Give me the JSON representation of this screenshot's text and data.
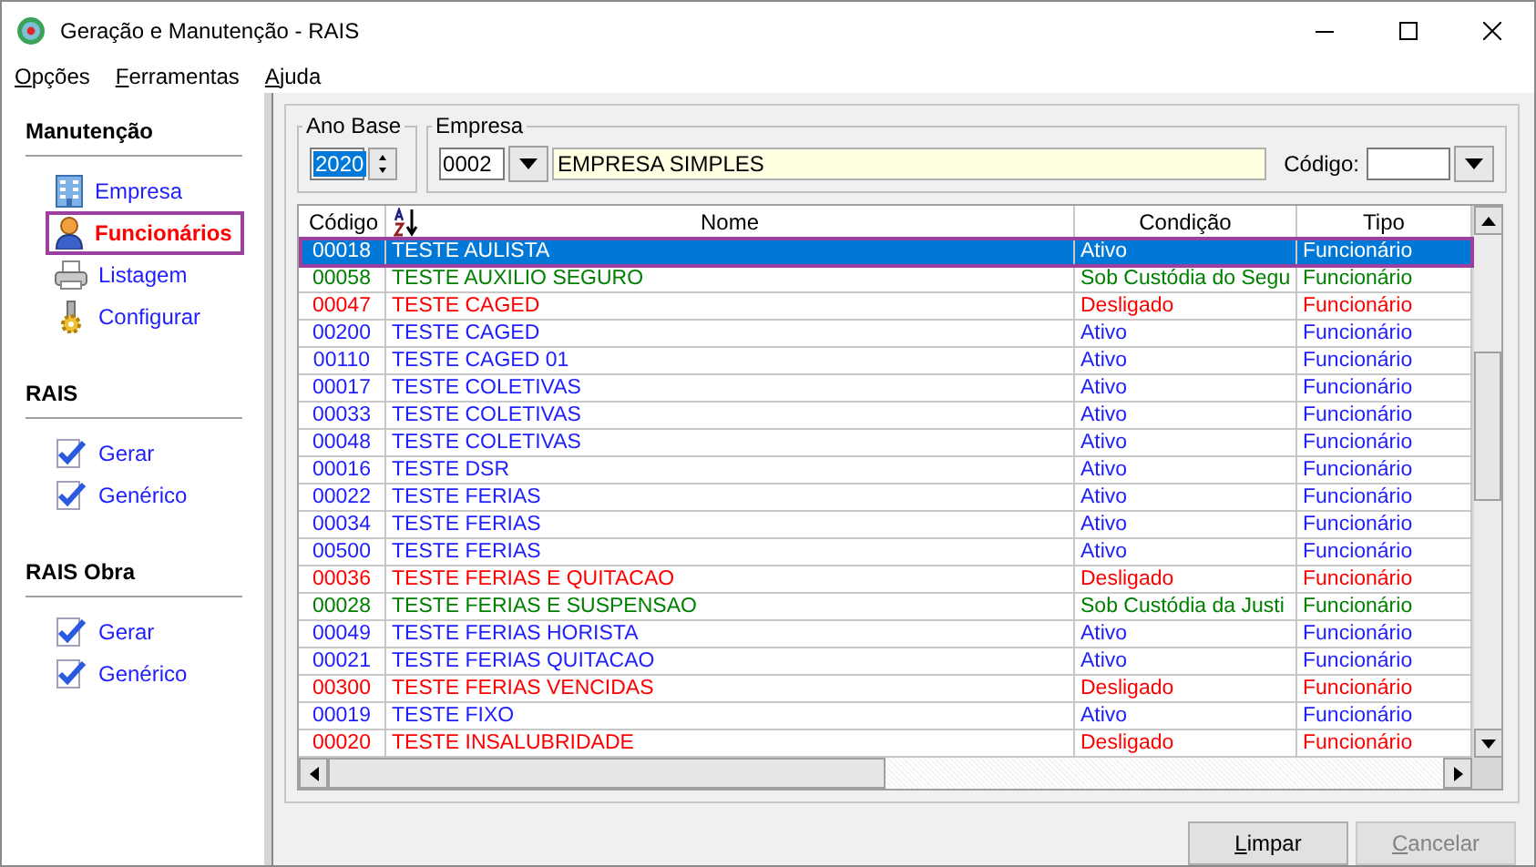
{
  "window": {
    "title": "Geração e Manutenção - RAIS"
  },
  "menu": [
    "Opções",
    "Ferramentas",
    "Ajuda"
  ],
  "sidebar": [
    {
      "title": "Manutenção",
      "items": [
        {
          "label": "Empresa",
          "kind": "building",
          "selected": false
        },
        {
          "label": "Funcionários",
          "kind": "person",
          "selected": true
        },
        {
          "label": "Listagem",
          "kind": "printer",
          "selected": false
        },
        {
          "label": "Configurar",
          "kind": "gear",
          "selected": false
        }
      ]
    },
    {
      "title": "RAIS",
      "items": [
        {
          "label": "Gerar",
          "kind": "check",
          "selected": false
        },
        {
          "label": "Genérico",
          "kind": "check",
          "selected": false
        }
      ]
    },
    {
      "title": "RAIS Obra",
      "items": [
        {
          "label": "Gerar",
          "kind": "check",
          "selected": false
        },
        {
          "label": "Genérico",
          "kind": "check",
          "selected": false
        }
      ]
    }
  ],
  "filters": {
    "ano_base": {
      "label": "Ano Base",
      "value": "2020"
    },
    "empresa": {
      "label": "Empresa",
      "code": "0002",
      "name": "EMPRESA SIMPLES"
    },
    "codigo": {
      "label": "Código:"
    }
  },
  "table": {
    "columns": [
      {
        "label": "Código",
        "sorted": false
      },
      {
        "label": "Nome",
        "sorted": true
      },
      {
        "label": "Condição",
        "sorted": false
      },
      {
        "label": "Tipo",
        "sorted": false
      }
    ],
    "rows": [
      {
        "code": "00018",
        "name": "TESTE AULISTA",
        "condition": "Ativo",
        "type": "Funcionário",
        "selected": true
      },
      {
        "code": "00058",
        "name": "TESTE AUXILIO SEGURO",
        "condition": "Sob Custódia do Segu",
        "type": "Funcionário",
        "color": "#008000",
        "selected": false
      },
      {
        "code": "00047",
        "name": "TESTE CAGED",
        "condition": "Desligado",
        "type": "Funcionário",
        "color": "#ff0000",
        "selected": false
      },
      {
        "code": "00200",
        "name": "TESTE CAGED",
        "condition": "Ativo",
        "type": "Funcionário",
        "color": "#1e1eff",
        "selected": false
      },
      {
        "code": "00110",
        "name": "TESTE CAGED 01",
        "condition": "Ativo",
        "type": "Funcionário",
        "color": "#1e1eff",
        "selected": false
      },
      {
        "code": "00017",
        "name": "TESTE COLETIVAS",
        "condition": "Ativo",
        "type": "Funcionário",
        "color": "#1e1eff",
        "selected": false
      },
      {
        "code": "00033",
        "name": "TESTE COLETIVAS",
        "condition": "Ativo",
        "type": "Funcionário",
        "color": "#1e1eff",
        "selected": false
      },
      {
        "code": "00048",
        "name": "TESTE COLETIVAS",
        "condition": "Ativo",
        "type": "Funcionário",
        "color": "#1e1eff",
        "selected": false
      },
      {
        "code": "00016",
        "name": "TESTE DSR",
        "condition": "Ativo",
        "type": "Funcionário",
        "color": "#1e1eff",
        "selected": false
      },
      {
        "code": "00022",
        "name": "TESTE FERIAS",
        "condition": "Ativo",
        "type": "Funcionário",
        "color": "#1e1eff",
        "selected": false
      },
      {
        "code": "00034",
        "name": "TESTE FERIAS",
        "condition": "Ativo",
        "type": "Funcionário",
        "color": "#1e1eff",
        "selected": false
      },
      {
        "code": "00500",
        "name": "TESTE FERIAS",
        "condition": "Ativo",
        "type": "Funcionário",
        "color": "#1e1eff",
        "selected": false
      },
      {
        "code": "00036",
        "name": "TESTE FERIAS E QUITACAO",
        "condition": "Desligado",
        "type": "Funcionário",
        "color": "#ff0000",
        "selected": false
      },
      {
        "code": "00028",
        "name": "TESTE FERIAS E SUSPENSAO",
        "condition": "Sob Custódia da Justi",
        "type": "Funcionário",
        "color": "#008000",
        "selected": false
      },
      {
        "code": "00049",
        "name": "TESTE FERIAS HORISTA",
        "condition": "Ativo",
        "type": "Funcionário",
        "color": "#1e1eff",
        "selected": false
      },
      {
        "code": "00021",
        "name": "TESTE FERIAS QUITACAO",
        "condition": "Ativo",
        "type": "Funcionário",
        "color": "#1e1eff",
        "selected": false
      },
      {
        "code": "00300",
        "name": "TESTE FERIAS VENCIDAS",
        "condition": "Desligado",
        "type": "Funcionário",
        "color": "#ff0000",
        "selected": false
      },
      {
        "code": "00019",
        "name": "TESTE FIXO",
        "condition": "Ativo",
        "type": "Funcionário",
        "color": "#1e1eff",
        "selected": false
      },
      {
        "code": "00020",
        "name": "TESTE INSALUBRIDADE",
        "condition": "Desligado",
        "type": "Funcionário",
        "color": "#ff0000",
        "selected": false
      }
    ]
  },
  "buttons": [
    {
      "label": "Limpar",
      "disabled": false
    },
    {
      "label": "Cancelar",
      "disabled": true
    }
  ]
}
